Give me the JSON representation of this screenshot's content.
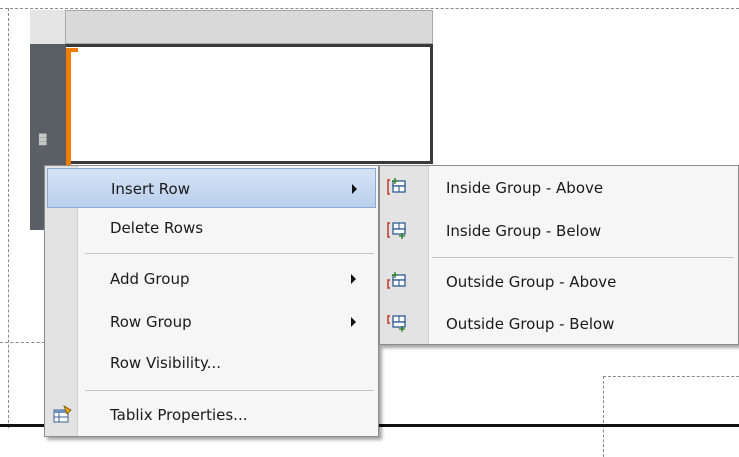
{
  "context_menu": {
    "items": [
      {
        "label": "Insert Row",
        "has_submenu": true,
        "highlighted": true
      },
      {
        "label": "Delete Rows",
        "has_submenu": false
      },
      {
        "label": "Add Group",
        "has_submenu": true
      },
      {
        "label": "Row Group",
        "has_submenu": true
      },
      {
        "label": "Row Visibility...",
        "has_submenu": false
      },
      {
        "label": "Tablix Properties...",
        "has_submenu": false,
        "icon": "tablix-properties-icon"
      }
    ]
  },
  "insert_row_submenu": {
    "items": [
      {
        "label": "Inside Group - Above",
        "icon": "insert-row-above-icon"
      },
      {
        "label": "Inside Group - Below",
        "icon": "insert-row-below-icon"
      },
      {
        "label": "Outside Group - Above",
        "icon": "insert-row-above-outside-icon"
      },
      {
        "label": "Outside Group - Below",
        "icon": "insert-row-below-outside-icon"
      }
    ]
  },
  "colors": {
    "highlight": "#b9cfec",
    "accent": "#f07c00",
    "handle": "#5a5f66"
  }
}
